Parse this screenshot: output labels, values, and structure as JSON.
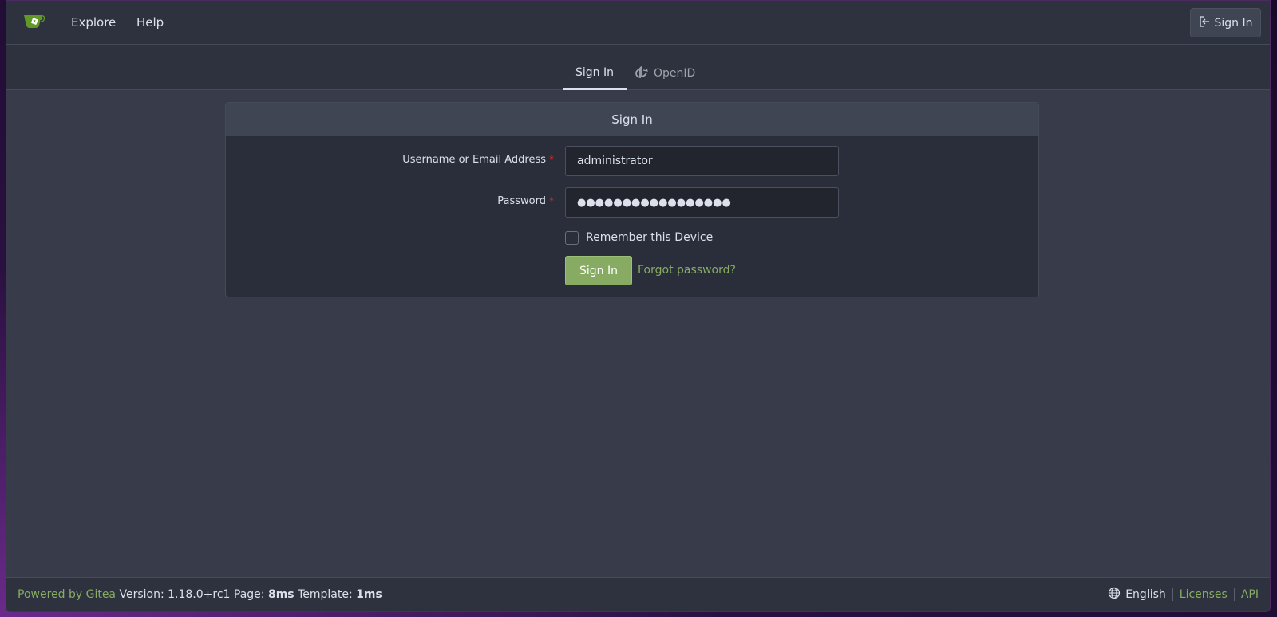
{
  "navbar": {
    "explore_label": "Explore",
    "help_label": "Help",
    "signin_label": "Sign In"
  },
  "tabs": [
    {
      "label": "Sign In",
      "active": true
    },
    {
      "label": "OpenID",
      "active": false
    }
  ],
  "form": {
    "header": "Sign In",
    "username_label": "Username or Email Address",
    "username_value": "administrator",
    "password_label": "Password",
    "password_value": "●●●●●●●●●●●●●●●●●",
    "required_marker": "*",
    "remember_label": "Remember this Device",
    "remember_checked": false,
    "submit_label": "Sign In",
    "forgot_label": "Forgot password?"
  },
  "footer": {
    "powered_by": "Powered by Gitea",
    "version_text": "Version: 1.18.0+rc1 Page:",
    "page_time": "8ms",
    "template_text": "Template:",
    "template_time": "1ms",
    "language": "English",
    "licenses": "Licenses",
    "api": "API"
  },
  "colors": {
    "accent": "#87ab63",
    "background": "#383c4a",
    "navbar": "#2e323e",
    "required": "#db2828"
  }
}
